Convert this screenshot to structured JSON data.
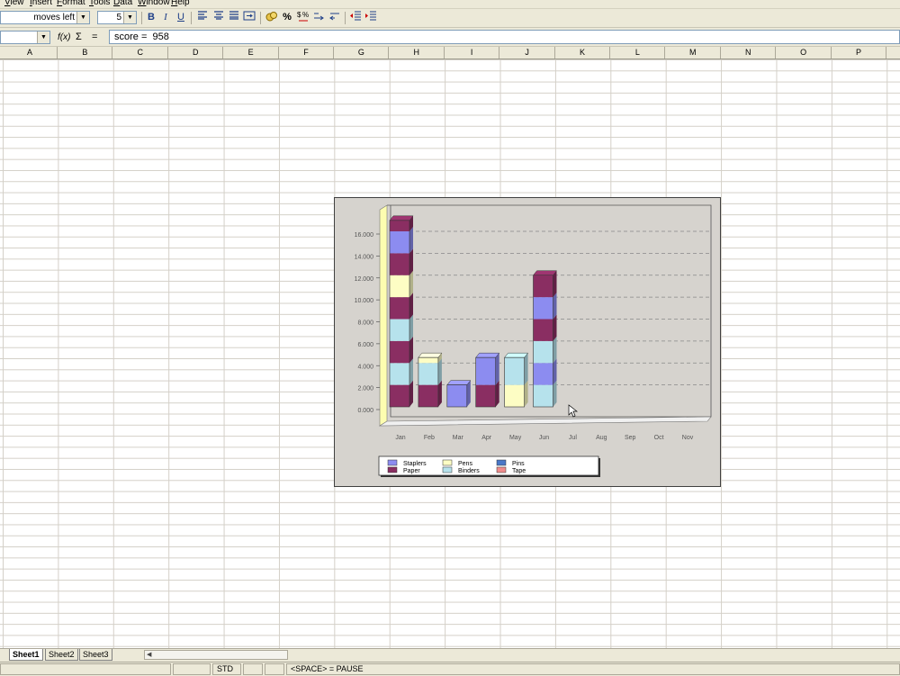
{
  "menu": {
    "items": [
      "View",
      "Insert",
      "Format",
      "Tools",
      "Data",
      "Window",
      "Help"
    ]
  },
  "toolbar": {
    "font_name": "moves left",
    "font_size": "5",
    "bold_label": "B",
    "italic_label": "I",
    "underline_label": "U",
    "percent_label": "%"
  },
  "formula_bar": {
    "name_box_value": "",
    "fx_label": "f(x)",
    "sum_label": "Σ",
    "equals_label": "=",
    "formula_value": "score =  958"
  },
  "columns": [
    "A",
    "B",
    "C",
    "D",
    "E",
    "F",
    "G",
    "H",
    "I",
    "J",
    "K",
    "L",
    "M",
    "N",
    "O",
    "P"
  ],
  "sheet_tabs": [
    "Sheet1",
    "Sheet2",
    "Sheet3"
  ],
  "active_sheet": "Sheet1",
  "status": {
    "mode": "STD",
    "message": "<SPACE> = PAUSE"
  },
  "chart_data": {
    "type": "bar",
    "stacked": true,
    "three_d": true,
    "categories": [
      "Jan",
      "Feb",
      "Mar",
      "Apr",
      "May",
      "Jun",
      "Jul",
      "Aug",
      "Sep",
      "Oct",
      "Nov"
    ],
    "y_tick_labels": [
      "0.000",
      "2.000",
      "4.000",
      "6.000",
      "8.000",
      "10.000",
      "12.000",
      "14.000",
      "16.000"
    ],
    "ylim": [
      0,
      17000
    ],
    "grid": "dashed horizontal",
    "legend_position": "bottom",
    "bars": [
      {
        "category": "Jan",
        "segments": [
          {
            "series": "Paper",
            "value": 2000
          },
          {
            "series": "Binders",
            "value": 2000
          },
          {
            "series": "Paper",
            "value": 2000
          },
          {
            "series": "Binders",
            "value": 2000
          },
          {
            "series": "Paper",
            "value": 2000
          },
          {
            "series": "Pens",
            "value": 2000
          },
          {
            "series": "Paper",
            "value": 2000
          },
          {
            "series": "Staplers",
            "value": 2000
          },
          {
            "series": "Paper",
            "value": 1000
          }
        ]
      },
      {
        "category": "Feb",
        "segments": [
          {
            "series": "Paper",
            "value": 2000
          },
          {
            "series": "Binders",
            "value": 2000
          },
          {
            "series": "Pens",
            "value": 500
          }
        ]
      },
      {
        "category": "Mar",
        "segments": [
          {
            "series": "Staplers",
            "value": 2000
          }
        ]
      },
      {
        "category": "Apr",
        "segments": [
          {
            "series": "Paper",
            "value": 2000
          },
          {
            "series": "Staplers",
            "value": 2500
          }
        ]
      },
      {
        "category": "May",
        "segments": [
          {
            "series": "Pens",
            "value": 2000
          },
          {
            "series": "Binders",
            "value": 2500
          }
        ]
      },
      {
        "category": "Jun",
        "segments": [
          {
            "series": "Binders",
            "value": 2000
          },
          {
            "series": "Staplers",
            "value": 2000
          },
          {
            "series": "Binders",
            "value": 2000
          },
          {
            "series": "Paper",
            "value": 2000
          },
          {
            "series": "Staplers",
            "value": 2000
          },
          {
            "series": "Paper",
            "value": 2000
          }
        ]
      }
    ],
    "legend": [
      {
        "name": "Staplers",
        "color": "#8c8cf0"
      },
      {
        "name": "Pens",
        "color": "#fdfdc4"
      },
      {
        "name": "Pins",
        "color": "#4a78c8"
      },
      {
        "name": "Paper",
        "color": "#8a2e62"
      },
      {
        "name": "Binders",
        "color": "#b6e2ec"
      },
      {
        "name": "Tape",
        "color": "#f08c8c"
      }
    ]
  }
}
